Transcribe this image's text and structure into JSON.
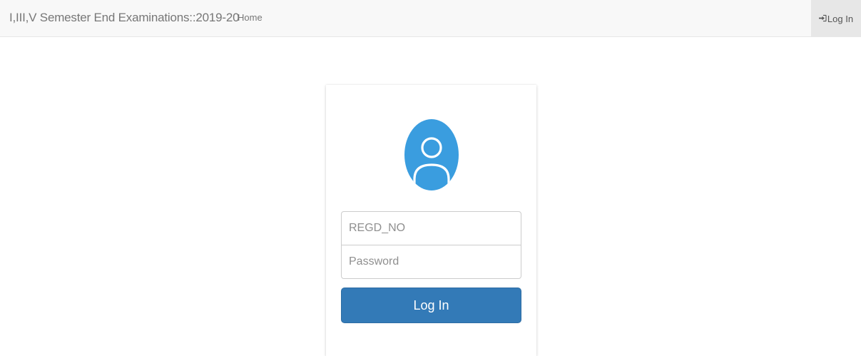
{
  "navbar": {
    "brand": "I,III,V Semester End Examinations::2019-20",
    "home_label": "Home",
    "login_label": "Log In",
    "login_icon": "log-in-icon"
  },
  "login_form": {
    "avatar_icon": "user-avatar-icon",
    "regd_placeholder": "REGD_NO",
    "password_placeholder": "Password",
    "submit_label": "Log In"
  },
  "colors": {
    "navbar_bg": "#f8f8f8",
    "navbar_active_bg": "#e7e7e7",
    "avatar_bg": "#3a9ddf",
    "primary_button": "#337ab7"
  }
}
